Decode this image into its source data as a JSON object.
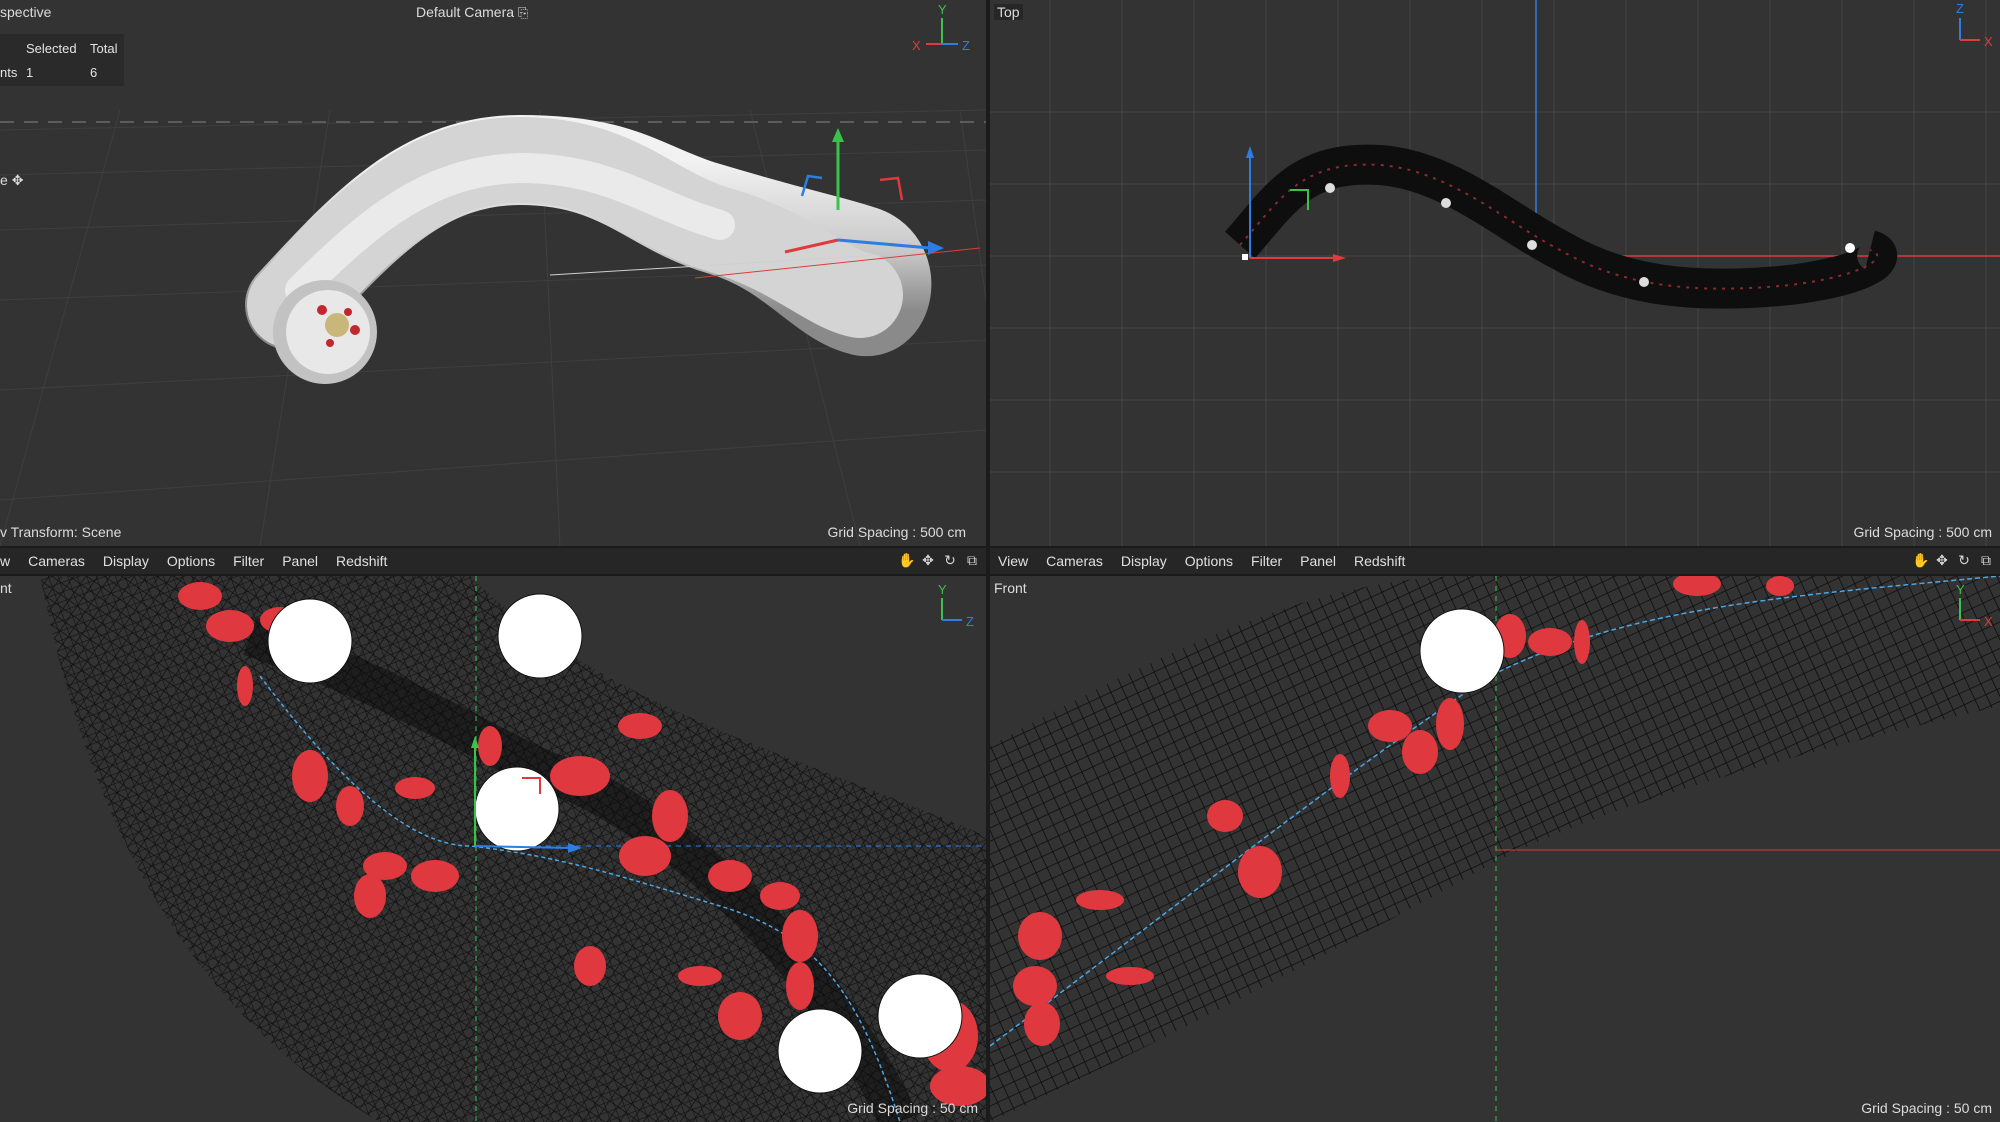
{
  "viewports": {
    "perspective": {
      "title": "spective",
      "camera_label": "Default Camera",
      "hud": {
        "header_selected": "Selected",
        "header_total": "Total",
        "row_label": "nts",
        "row_selected": "1",
        "row_total": "6"
      },
      "move_label": "e",
      "transform_label": "v Transform: Scene",
      "grid_spacing": "Grid Spacing : 500 cm"
    },
    "top": {
      "title": "Top",
      "grid_spacing": "Grid Spacing : 500 cm"
    },
    "right": {
      "title": "nt",
      "grid_spacing": "Grid Spacing : 50 cm"
    },
    "front": {
      "title": "Front",
      "grid_spacing": "Grid Spacing : 50 cm"
    }
  },
  "menubar_left": [
    "w",
    "Cameras",
    "Display",
    "Options",
    "Filter",
    "Panel",
    "Redshift"
  ],
  "menubar_right": [
    "View",
    "Cameras",
    "Display",
    "Options",
    "Filter",
    "Panel",
    "Redshift"
  ],
  "axis_labels": {
    "x": "X",
    "y": "Y",
    "z": "Z"
  },
  "colors": {
    "viewport_bg": "#333333",
    "axis_x": "#e03a3a",
    "axis_y": "#3ac24a",
    "axis_z": "#2f7de0",
    "blood_cell": "#e0383f",
    "white_cell": "#ffffff"
  },
  "icons": [
    "hand-icon",
    "move-arrows-icon",
    "rotate-icon",
    "maximize-icon",
    "camera-icon",
    "move-gizmo-icon"
  ]
}
